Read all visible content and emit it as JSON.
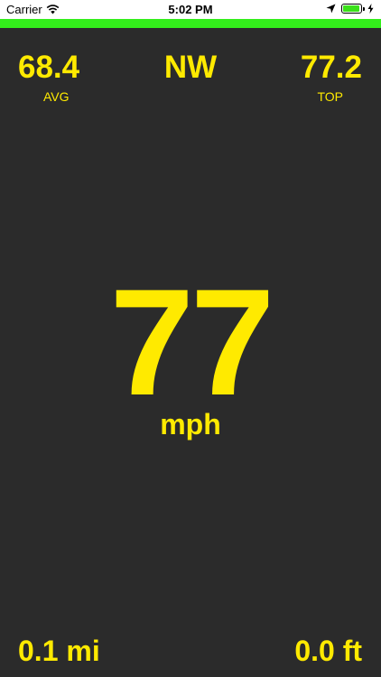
{
  "status_bar": {
    "carrier": "Carrier",
    "time": "5:02 PM",
    "icons": [
      "wifi-icon",
      "location-arrow-icon",
      "battery-icon",
      "charging-bolt-icon"
    ]
  },
  "colors": {
    "background": "#2b2b2b",
    "accent_bar": "#33ee1b",
    "text": "#ffea00"
  },
  "stats": {
    "avg_value": "68.4",
    "avg_label": "AVG",
    "heading": "NW",
    "top_value": "77.2",
    "top_label": "TOP"
  },
  "speed": {
    "value": "77",
    "unit": "mph"
  },
  "footer": {
    "distance": "0.1 mi",
    "altitude": "0.0 ft"
  }
}
